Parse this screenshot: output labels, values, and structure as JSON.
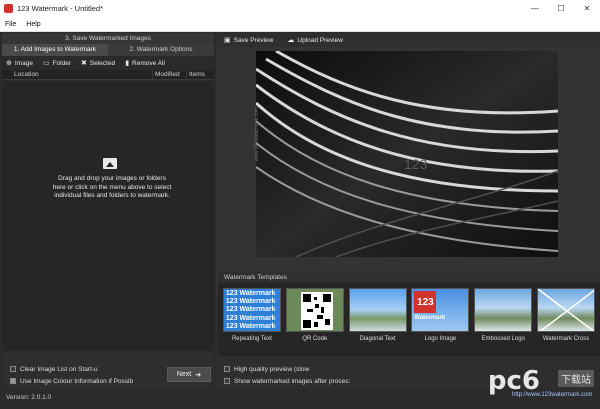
{
  "window": {
    "title": "123 Watermark - Untitled*",
    "controls": [
      "—",
      "☐",
      "✕"
    ]
  },
  "menu": [
    "File",
    "Help"
  ],
  "left": {
    "tab_top": "3. Save Watermarked Images",
    "tabs": [
      "1. Add Images to Watermark",
      "2. Watermark Options"
    ],
    "toolbar": [
      {
        "icon": "plus-icon",
        "label": "Image"
      },
      {
        "icon": "folder-icon",
        "label": "Folder"
      },
      {
        "icon": "x-icon",
        "label": "Selected"
      },
      {
        "icon": "trash-icon",
        "label": "Remove All"
      }
    ],
    "columns": {
      "location": "Location",
      "modified": "Modified",
      "items": "Items"
    },
    "drop_text": "Drag and drop your images or folders here or click on the menu above to select individual files and folders to watermark.",
    "checks": [
      {
        "label": "Clear Image List on Start-u",
        "checked": false
      },
      {
        "label": "Use Image Colour Information if Possib",
        "checked": true
      }
    ],
    "next": "Next"
  },
  "right": {
    "toolbar": [
      {
        "icon": "save-icon",
        "label": "Save Preview"
      },
      {
        "icon": "upload-icon",
        "label": "Upload Preview"
      }
    ],
    "preview_watermark": "www.123watermark.com",
    "templates_title": "Watermark Templates",
    "templates": [
      {
        "label": "Repeating Text",
        "lines": [
          "123 Watermark",
          "123 Watermark",
          "123 Watermark",
          "123 Watermark",
          "123 Watermark"
        ]
      },
      {
        "label": "QR Code"
      },
      {
        "label": "Diagonal Text"
      },
      {
        "label": "Logo Image",
        "logo_text": "123",
        "logo_sub": "Watermark"
      },
      {
        "label": "Embossed Logo"
      },
      {
        "label": "Watermark Cross"
      }
    ],
    "checks": [
      {
        "label": "High quality preview (slow",
        "checked": false
      },
      {
        "label": "Show watermarked images after proces:",
        "checked": false
      }
    ]
  },
  "status": {
    "version": "Version: 2.0.1.0"
  },
  "site_watermark": {
    "logo": "pc6",
    "tag": "下载站",
    "url": "http://www.123watermark.com"
  }
}
